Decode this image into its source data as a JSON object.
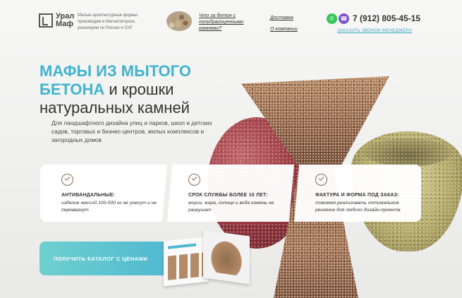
{
  "header": {
    "logo_line1": "Урал",
    "logo_line2": "Маф",
    "tagline": "Малые архитектурные формы: производим в Магнитогорске, реализуем по России и СНГ",
    "stone_link": "Что за бетон с полудрагоценными камнями?",
    "nav": {
      "delivery": "Доставка",
      "about": "О компании"
    },
    "phone": "7 (912) 805-45-15",
    "callback": "ЗАКАЗАТЬ ЗВОНОК МЕНЕДЖЕРА",
    "whatsapp_glyph": "✆",
    "viber_glyph": "☎"
  },
  "hero": {
    "title_accent1": "МАФЫ ИЗ МЫТОГО",
    "title_accent2": "БЕТОНА",
    "title_rest1": " и крошки",
    "title_rest2": "натуральных камней",
    "subtitle": "Для ландшафтного дизайна улиц и парков, школ и детских садов, торговых и бизнес-центров, жилых комплексов и загородных домов"
  },
  "cards": [
    {
      "title": "АНТИВАНДАЛЬНЫЕ:",
      "desc": "изделие массой 100-500 кг не унесут и не перевернут"
    },
    {
      "title": "СРОК СЛУЖБЫ БОЛЕЕ 10 ЛЕТ:",
      "desc": "мороз, жара, солнце и вода камень не разрушат"
    },
    {
      "title": "ФАКТУРА И ФОРМА ПОД ЗАКАЗ:",
      "desc": "поможем реализовать оптимальное решение для любого дизайн-проекта"
    }
  ],
  "cta": {
    "label": "ПОЛУЧИТЬ КАТАЛОГ С ЦЕНАМИ"
  },
  "colors": {
    "accent": "#41b3cf",
    "cta_start": "#6fd0cf",
    "cta_end": "#4fb8d0",
    "whatsapp": "#35c65a",
    "viber": "#7b56c8"
  }
}
